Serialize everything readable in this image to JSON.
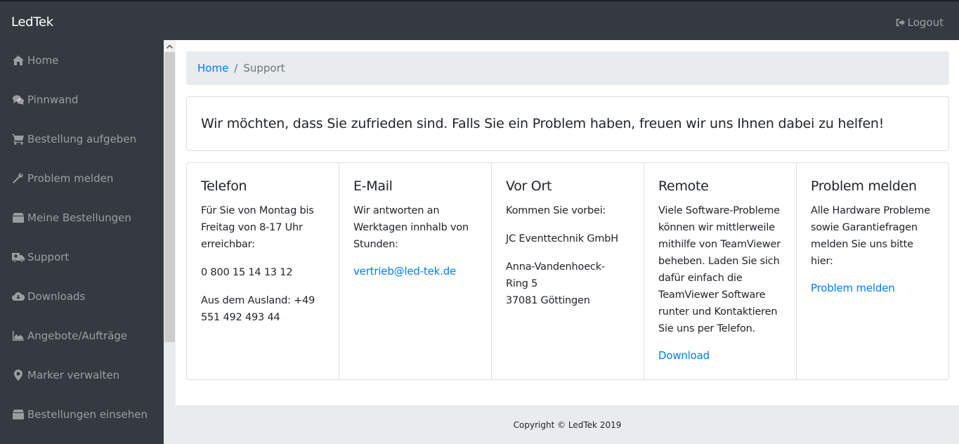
{
  "header": {
    "brand": "LedTek",
    "logout_label": "Logout",
    "logout_icon": "sign-out-icon"
  },
  "sidebar": {
    "items": [
      {
        "label": "Home",
        "icon": "home-icon"
      },
      {
        "label": "Pinnwand",
        "icon": "comments-icon"
      },
      {
        "label": "Bestellung aufgeben",
        "icon": "shopping-cart-icon"
      },
      {
        "label": "Problem melden",
        "icon": "wrench-icon"
      },
      {
        "label": "Meine Bestellungen",
        "icon": "box-icon"
      },
      {
        "label": "Support",
        "icon": "ambulance-icon"
      },
      {
        "label": "Downloads",
        "icon": "cloud-download-icon"
      },
      {
        "label": "Angebote/Aufträge",
        "icon": "area-chart-icon"
      },
      {
        "label": "Marker verwalten",
        "icon": "map-marker-icon"
      },
      {
        "label": "Bestellungen einsehen",
        "icon": "box-icon"
      }
    ]
  },
  "breadcrumb": {
    "home": "Home",
    "separator": "/",
    "current": "Support"
  },
  "intro": "Wir möchten, dass Sie zufrieden sind. Falls Sie ein Problem haben, freuen wir uns Ihnen dabei zu helfen!",
  "cards": {
    "telefon": {
      "title": "Telefon",
      "text": "Für Sie von Montag bis Freitag von 8-17 Uhr erreichbar:",
      "phone": "0 800 15 14 13 12",
      "abroad": "Aus dem Ausland: +49 551 492 493 44"
    },
    "email": {
      "title": "E-Mail",
      "text": "Wir antworten an Werktagen innhalb von Stunden:",
      "link": "vertrieb@led-tek.de"
    },
    "vor_ort": {
      "title": "Vor Ort",
      "text": "Kommen Sie vorbei:",
      "company": "JC Eventtechnik GmbH",
      "street": "Anna-Vandenhoeck-Ring 5",
      "city": "37081 Göttingen"
    },
    "remote": {
      "title": "Remote",
      "text": "Viele Software-Probleme können wir mittlerweile mithilfe von TeamViewer beheben. Laden Sie sich dafür einfach die TeamViewer Software runter und Kontaktieren Sie uns per Telefon.",
      "link": "Download"
    },
    "problem": {
      "title": "Problem melden",
      "text": "Alle Hardware Probleme sowie Garantiefragen melden Sie uns bitte hier:",
      "link": "Problem melden"
    }
  },
  "footer": {
    "copyright": "Copyright © LedTek 2019"
  },
  "colors": {
    "sidebar_bg": "#343a40",
    "link": "#007bff",
    "breadcrumb_bg": "#e9ecef"
  }
}
